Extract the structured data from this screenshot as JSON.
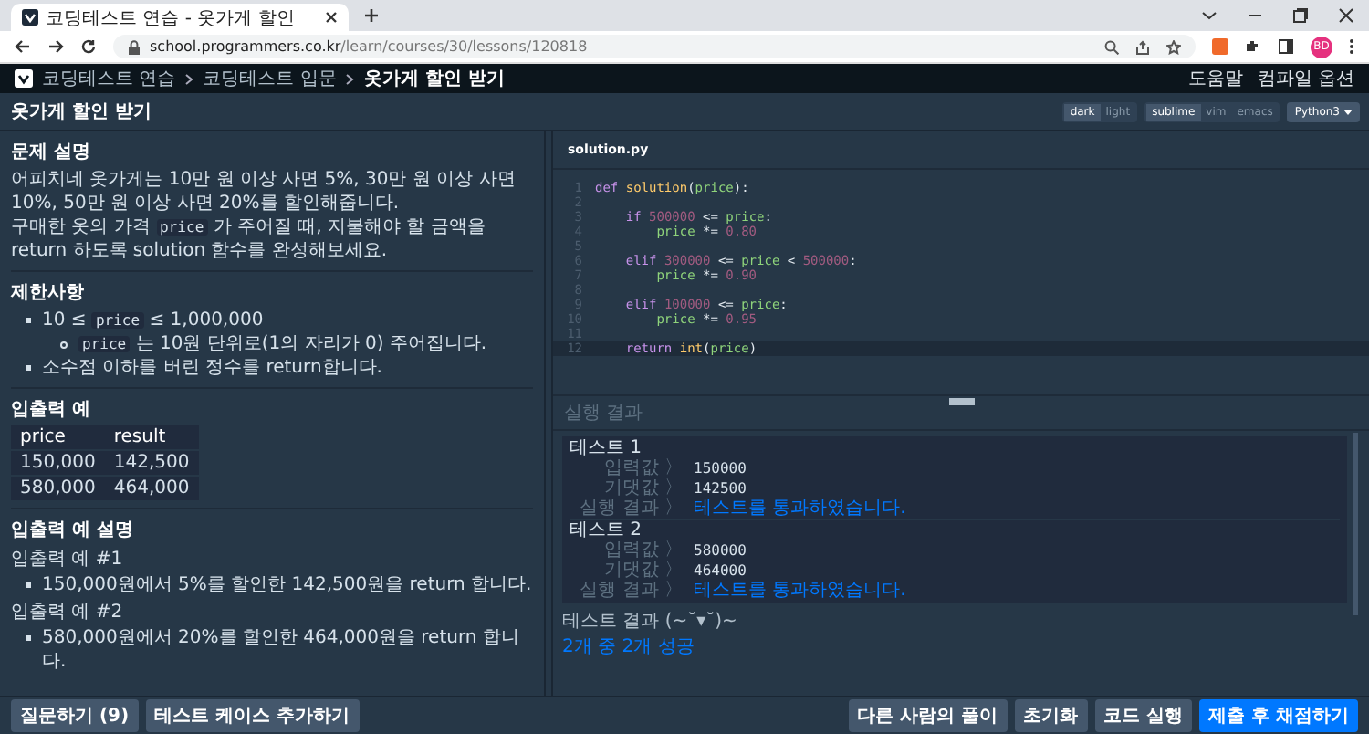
{
  "browser": {
    "tab_title": "코딩테스트 연습 - 옷가게 할인",
    "url_host": "school.programmers.co.kr",
    "url_path": "/learn/courses/30/lessons/120818",
    "profile": "BD"
  },
  "nav": {
    "breadcrumbs": [
      "코딩테스트 연습",
      "코딩테스트 입문",
      "옷가게 할인 받기"
    ],
    "links": [
      "도움말",
      "컴파일 옵션"
    ]
  },
  "problem_title": "옷가게 할인 받기",
  "options": {
    "themes": [
      {
        "label": "dark",
        "selected": true
      },
      {
        "label": "light",
        "selected": false
      }
    ],
    "keymaps": [
      {
        "label": "sublime",
        "selected": true
      },
      {
        "label": "vim",
        "selected": false
      },
      {
        "label": "emacs",
        "selected": false
      }
    ],
    "language": "Python3"
  },
  "description": {
    "heading": "문제 설명",
    "paragraphs": [
      [
        {
          "kind": "text",
          "text": "어피치네 옷가게는 10만 원 이상 사면 5%, 30만 원 이상 사면 10%, 50만 원 이상 사면 20%를 할인해줍니다."
        }
      ],
      [
        {
          "kind": "text",
          "text": "구매한 옷의 가격 "
        },
        {
          "kind": "code",
          "text": "price"
        },
        {
          "kind": "text",
          "text": " 가 주어질 때, 지불해야 할 금액을 return 하도록 solution 함수를 완성해보세요."
        }
      ]
    ]
  },
  "constraints": {
    "heading": "제한사항",
    "items": [
      {
        "parts": [
          {
            "kind": "text",
            "text": "10 ≤ "
          },
          {
            "kind": "code",
            "text": "price"
          },
          {
            "kind": "text",
            "text": " ≤ 1,000,000"
          }
        ],
        "children": [
          {
            "parts": [
              {
                "kind": "code",
                "text": "price"
              },
              {
                "kind": "text",
                "text": " 는 10원 단위로(1의 자리가 0) 주어집니다."
              }
            ]
          }
        ]
      },
      {
        "parts": [
          {
            "kind": "text",
            "text": "소수점 이하를 버린 정수를 return합니다."
          }
        ]
      }
    ]
  },
  "examples": {
    "heading": "입출력 예",
    "columns": [
      "price",
      "result"
    ],
    "rows": [
      [
        "150,000",
        "142,500"
      ],
      [
        "580,000",
        "464,000"
      ]
    ]
  },
  "explanation": {
    "heading": "입출력 예 설명",
    "groups": [
      {
        "title": "입출력 예 #1",
        "items": [
          "150,000원에서 5%를 할인한 142,500원을 return 합니다."
        ]
      },
      {
        "title": "입출력 예 #2",
        "items": [
          "580,000원에서 20%를 할인한 464,000원을 return 합니다."
        ]
      }
    ]
  },
  "editor": {
    "filename": "solution.py",
    "lines": [
      {
        "number": "1",
        "active": false,
        "tokens": [
          {
            "kind": "keyword",
            "text": "def "
          },
          {
            "kind": "function",
            "text": "solution"
          },
          {
            "kind": "plain",
            "text": "("
          },
          {
            "kind": "variable",
            "text": "price"
          },
          {
            "kind": "plain",
            "text": "):"
          }
        ]
      },
      {
        "number": "2",
        "active": false
      },
      {
        "number": "3",
        "active": false,
        "tokens": [
          {
            "kind": "keyword",
            "text": "    if "
          },
          {
            "kind": "number",
            "text": "500000"
          },
          {
            "kind": "plain",
            "text": " <= "
          },
          {
            "kind": "variable",
            "text": "price"
          },
          {
            "kind": "plain",
            "text": ":"
          }
        ]
      },
      {
        "number": "4",
        "active": false,
        "tokens": [
          {
            "kind": "variable",
            "text": "        price"
          },
          {
            "kind": "plain",
            "text": " *= "
          },
          {
            "kind": "number",
            "text": "0.80"
          }
        ]
      },
      {
        "number": "5",
        "active": false
      },
      {
        "number": "6",
        "active": false,
        "tokens": [
          {
            "kind": "keyword",
            "text": "    elif "
          },
          {
            "kind": "number",
            "text": "300000"
          },
          {
            "kind": "plain",
            "text": " <= "
          },
          {
            "kind": "variable",
            "text": "price"
          },
          {
            "kind": "plain",
            "text": " < "
          },
          {
            "kind": "number",
            "text": "500000"
          },
          {
            "kind": "plain",
            "text": ":"
          }
        ]
      },
      {
        "number": "7",
        "active": false,
        "tokens": [
          {
            "kind": "variable",
            "text": "        price"
          },
          {
            "kind": "plain",
            "text": " *= "
          },
          {
            "kind": "number",
            "text": "0.90"
          }
        ]
      },
      {
        "number": "8",
        "active": false
      },
      {
        "number": "9",
        "active": false,
        "tokens": [
          {
            "kind": "keyword",
            "text": "    elif "
          },
          {
            "kind": "number",
            "text": "100000"
          },
          {
            "kind": "plain",
            "text": " <= "
          },
          {
            "kind": "variable",
            "text": "price"
          },
          {
            "kind": "plain",
            "text": ":"
          }
        ]
      },
      {
        "number": "10",
        "active": false,
        "tokens": [
          {
            "kind": "variable",
            "text": "        price"
          },
          {
            "kind": "plain",
            "text": " *= "
          },
          {
            "kind": "number",
            "text": "0.95"
          }
        ]
      },
      {
        "number": "11",
        "active": false
      },
      {
        "number": "12",
        "active": true,
        "tokens": [
          {
            "kind": "keyword",
            "text": "    return "
          },
          {
            "kind": "function",
            "text": "int"
          },
          {
            "kind": "plain",
            "text": "("
          },
          {
            "kind": "variable",
            "text": "price"
          },
          {
            "kind": "plain",
            "text": ")"
          }
        ]
      }
    ]
  },
  "results": {
    "heading": "실행 결과",
    "tests": [
      {
        "title": "테스트 1",
        "rows": [
          {
            "label": "입력값 〉",
            "value": "150000",
            "kind": "value"
          },
          {
            "label": "기댓값 〉",
            "value": "142500",
            "kind": "value"
          },
          {
            "label": "실행 결과 〉",
            "value": "테스트를 통과하였습니다.",
            "kind": "pass"
          }
        ]
      },
      {
        "title": "테스트 2",
        "rows": [
          {
            "label": "입력값 〉",
            "value": "580000",
            "kind": "value"
          },
          {
            "label": "기댓값 〉",
            "value": "464000",
            "kind": "value"
          },
          {
            "label": "실행 결과 〉",
            "value": "테스트를 통과하였습니다.",
            "kind": "pass"
          }
        ]
      }
    ],
    "summary_label": "테스트 결과 (~˘▾˘)~",
    "summary": "2개 중 2개 성공"
  },
  "footer": {
    "left_buttons": [
      "질문하기 (9)",
      "테스트 케이스 추가하기"
    ],
    "right_buttons": [
      {
        "label": "다른 사람의 풀이",
        "kind": "secondary"
      },
      {
        "label": "초기화",
        "kind": "secondary"
      },
      {
        "label": "코드 실행",
        "kind": "secondary"
      },
      {
        "label": "제출 후 채점하기",
        "kind": "primary"
      }
    ]
  }
}
